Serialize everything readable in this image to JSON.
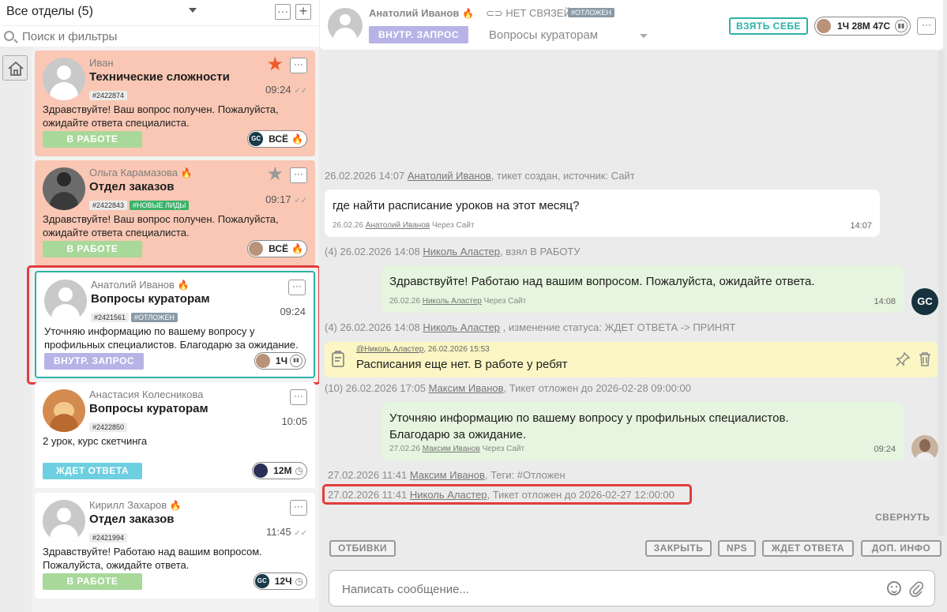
{
  "sidebar": {
    "department_title": "Все отделы (5)",
    "menu_glyph": "···",
    "add_glyph": "+",
    "search_placeholder": "Поиск и фильтры"
  },
  "tickets": [
    {
      "name": "Иван",
      "subject": "Технические сложности",
      "id": "#2422874",
      "time": "09:24",
      "message": "Здравствуйте! Ваш вопрос получен. Пожалуйста, ожидайте ответа специалиста.",
      "status": "В РАБОТЕ",
      "pill_avatar": "GC",
      "pill_text": "ВСЁ",
      "starred": true
    },
    {
      "name": "Ольга Карамазова",
      "subject": "Отдел заказов",
      "id": "#2422843",
      "tag": "#НОВЫЕ ЛИДЫ",
      "time": "09:17",
      "message": "Здравствуйте! Ваш вопрос получен. Пожалуйста, ожидайте ответа специалиста.",
      "status": "В РАБОТЕ",
      "pill_text": "ВСЁ",
      "starred": false
    },
    {
      "name": "Анатолий Иванов",
      "subject": "Вопросы кураторам",
      "id": "#2421561",
      "tag": "#ОТЛОЖЕН",
      "time": "09:24",
      "message": "Уточняю информацию по вашему вопросу у профильных специалистов. Благодарю за ожидание.",
      "status": "ВНУТР. ЗАПРОС",
      "pill_text": "1Ч"
    },
    {
      "name": "Анастасия Колесникова",
      "subject": "Вопросы кураторам",
      "id": "#2422850",
      "time": "10:05",
      "message": "2 урок, курс скетчинга",
      "status": "ЖДЕТ ОТВЕТА",
      "pill_text": "12М"
    },
    {
      "name": "Кирилл Захаров",
      "subject": "Отдел заказов",
      "id": "#2421994",
      "time": "11:45",
      "message": "Здравствуйте! Работаю над вашим вопросом. Пожалуйста, ожидайте ответа.",
      "status": "В РАБОТЕ",
      "pill_avatar": "GC",
      "pill_text": "12Ч"
    }
  ],
  "header": {
    "client_name": "Анатолий Иванов",
    "no_links": "НЕТ СВЯЗЕЙ",
    "tag": "#ОТЛОЖЕН",
    "internal": "ВНУТР. ЗАПРОС",
    "topic": "Вопросы кураторам",
    "take_button": "ВЗЯТЬ СЕБЕ",
    "timer": "1Ч 28М 47С",
    "menu_glyph": "···"
  },
  "chat": {
    "sys1": {
      "date": "26.02.2026 14:07",
      "user": "Анатолий Иванов",
      "text": ", тикет создан, источник: Сайт"
    },
    "msg1": {
      "text": "где найти расписание уроков на этот месяц?",
      "date": "26.02.26",
      "user": "Анатолий Иванов",
      "via": "Через Сайт",
      "time": "14:07"
    },
    "sys2": {
      "prefix": "(4) 26.02.2026 14:08",
      "user": "Николь Аластер",
      "text": ", взял В РАБОТУ"
    },
    "msg2": {
      "text": "Здравствуйте! Работаю над вашим вопросом. Пожалуйста, ожидайте ответа.",
      "date": "26.02.26",
      "user": "Николь Аластер",
      "via": "Через Сайт",
      "time": "14:08",
      "avatar": "GC"
    },
    "sys3": {
      "prefix": "(4) 26.02.2026 14:08",
      "user": "Николь Аластер",
      "text": ", изменение статуса: ЖДЕТ ОТВЕТА -> ПРИНЯТ"
    },
    "note": {
      "user": "@Николь Аластер",
      "date": ", 26.02.2026 15:53",
      "text": "Расписания еще нет. В работе у ребят"
    },
    "sys4": {
      "prefix": "(10) 26.02.2026 17:05",
      "user": "Максим Иванов",
      "text": ", Тикет отложен до 2026-02-28 09:00:00"
    },
    "msg3": {
      "line1": "Уточняю информацию по вашему вопросу у профильных специалистов.",
      "line2": "Благодарю за ожидание.",
      "date": "27.02.26",
      "user": "Максим Иванов",
      "via": "Через Сайт",
      "time": "09:24"
    },
    "sys5": {
      "date": "27.02.2026 11:41",
      "user": "Максим Иванов",
      "text": ", Теги: #Отложен"
    },
    "sys6": {
      "date": "27.02.2026 11:41",
      "user": "Николь Аластер",
      "text": ", Тикет отложен до 2026-02-27 12:00:00"
    },
    "collapse": "СВЕРНУТЬ"
  },
  "actions": {
    "left": "ОТБИВКИ",
    "close": "ЗАКРЫТЬ",
    "nps": "NPS",
    "wait": "ЖДЕТ ОТВЕТА",
    "info": "ДОП. ИНФО"
  },
  "compose": {
    "placeholder": "Написать сообщение..."
  }
}
